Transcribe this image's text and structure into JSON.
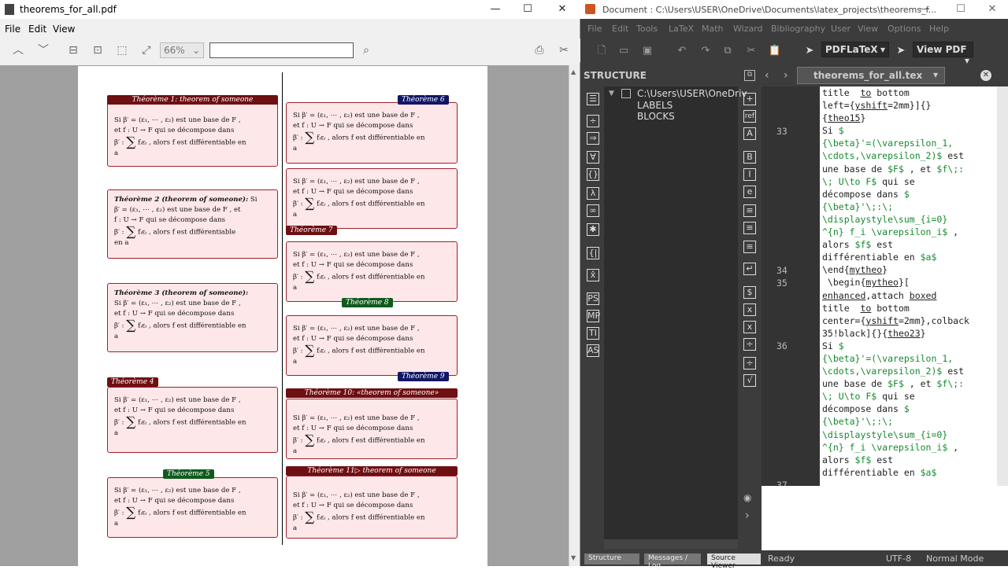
{
  "pdf": {
    "title": "theorems_for_all.pdf",
    "menu": [
      "File",
      "Edit",
      "View"
    ],
    "zoom": "66%",
    "search_placeholder": "",
    "theorem_body": {
      "line1": "Si β′ = (ε₁, ⋯ , ε₂) est une base de F ,",
      "line2": "et f : U → F qui se décompose dans",
      "line3_pre": "β′ :",
      "line3_post": "fᵢεᵢ , alors f est différentiable en",
      "line4": "a"
    },
    "theorems": [
      {
        "title": "Théorème 1: theorem of someone",
        "style": "red"
      },
      {
        "title": "Théorème 2 (theorem of someone):",
        "style": "inline"
      },
      {
        "title": "Théorème 3 (theorem of someone):",
        "style": "inline"
      },
      {
        "title": "Théorème 4",
        "style": "red"
      },
      {
        "title": "Théorème 5",
        "style": "green"
      },
      {
        "title": "Théorème 6",
        "style": "blue"
      },
      {
        "title": "Théorème 7",
        "style": "red"
      },
      {
        "title": "Théorème 8",
        "style": "green"
      },
      {
        "title": "Théorème 9",
        "style": "blue"
      },
      {
        "title": "Théorème 10: «theorem of someone»",
        "style": "red"
      },
      {
        "title": "Théorème 11▷ theorem of someone",
        "style": "red"
      }
    ],
    "th2_extra": {
      "a": "Si",
      "b": "β′ = (ε₁, ⋯ , ε₂) est une base de F , et",
      "c": "f : U → F qui se décompose dans",
      "d": "β′ :",
      "e": "fᵢεᵢ , alors f est différentiable",
      "f": "en a"
    },
    "th3_first": "Si β′ = (ε₁, ⋯ , ε₂) est une base de F ,"
  },
  "tx": {
    "title": "Document : C:\\Users\\USER\\OneDrive\\Documents\\latex_projects\\theorems_f...",
    "menu": [
      "File",
      "Edit",
      "Tools",
      "LaTeX",
      "Math",
      "Wizard",
      "Bibliography",
      "User",
      "View",
      "Options",
      "Help"
    ],
    "compiler": "PDFLaTeX",
    "viewer": "View PDF",
    "structure_label": "STRUCTURE",
    "tree": {
      "root": "C:\\Users\\USER\\OneDriv",
      "labels": "LABELS",
      "blocks": "BLOCKS"
    },
    "file_tab": "theorems_for_all.tex",
    "line_numbers": {
      "n33": "33",
      "n34": "34",
      "n35": "35",
      "n36": "36",
      "n37": "37"
    },
    "status": {
      "structure": "Structure",
      "messages": "Messages / Log",
      "source": "Source Viewer",
      "ready": "Ready",
      "encoding": "UTF-8",
      "mode": "Normal Mode"
    },
    "icons_side": [
      "PS",
      "MP",
      "TI",
      "AS"
    ]
  }
}
